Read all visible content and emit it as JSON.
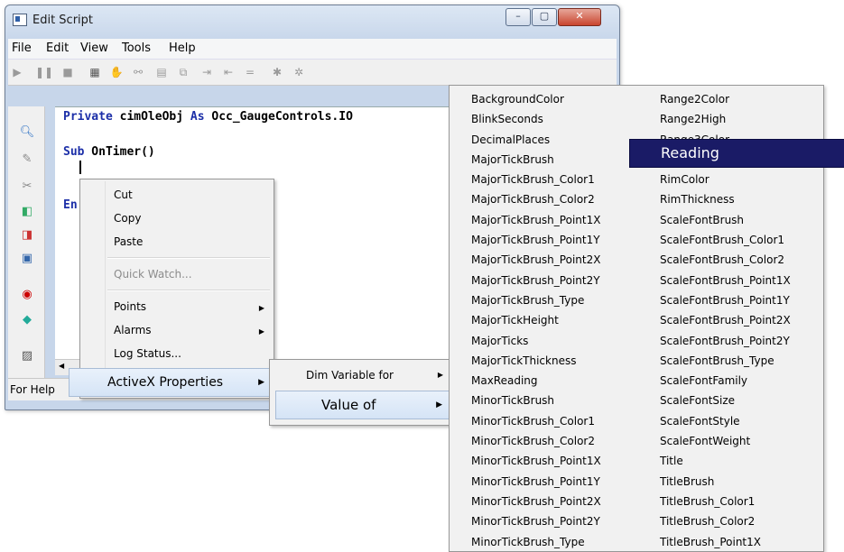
{
  "window": {
    "title": "Edit Script",
    "controls": {
      "minimize": "–",
      "maximize": "▢",
      "close": "✕"
    }
  },
  "menubar": [
    "File",
    "Edit",
    "View",
    "Tools",
    "Help"
  ],
  "code": {
    "line1_kw": "Private",
    "line1_rest": " cimOleObj ",
    "line1_kw2": "As",
    "line1_rest2": " Occ_GaugeControls.IO",
    "line2_kw": "Sub",
    "line2_rest": " OnTimer()",
    "line4_kw": "En"
  },
  "status": {
    "text": "For Help"
  },
  "context_menu": {
    "cut": "Cut",
    "copy": "Copy",
    "paste": "Paste",
    "quick_watch": "Quick Watch...",
    "points": "Points",
    "alarms": "Alarms",
    "log_status": "Log Status...",
    "activex": "ActiveX Properties"
  },
  "submenu": {
    "dim_variable": "Dim Variable for",
    "value_of": "Value of"
  },
  "properties": {
    "col1": [
      "BackgroundColor",
      "BlinkSeconds",
      "DecimalPlaces",
      "MajorTickBrush",
      "MajorTickBrush_Color1",
      "MajorTickBrush_Color2",
      "MajorTickBrush_Point1X",
      "MajorTickBrush_Point1Y",
      "MajorTickBrush_Point2X",
      "MajorTickBrush_Point2Y",
      "MajorTickBrush_Type",
      "MajorTickHeight",
      "MajorTicks",
      "MajorTickThickness",
      "MaxReading",
      "MinorTickBrush",
      "MinorTickBrush_Color1",
      "MinorTickBrush_Color2",
      "MinorTickBrush_Point1X",
      "MinorTickBrush_Point1Y",
      "MinorTickBrush_Point2X",
      "MinorTickBrush_Point2Y",
      "MinorTickBrush_Type"
    ],
    "col2": [
      "Range2Color",
      "Range2High",
      "Range3Color",
      "Reading",
      "RimColor",
      "RimThickness",
      "ScaleFontBrush",
      "ScaleFontBrush_Color1",
      "ScaleFontBrush_Color2",
      "ScaleFontBrush_Point1X",
      "ScaleFontBrush_Point1Y",
      "ScaleFontBrush_Point2X",
      "ScaleFontBrush_Point2Y",
      "ScaleFontBrush_Type",
      "ScaleFontFamily",
      "ScaleFontSize",
      "ScaleFontStyle",
      "ScaleFontWeight",
      "Title",
      "TitleBrush",
      "TitleBrush_Color1",
      "TitleBrush_Color2",
      "TitleBrush_Point1X"
    ],
    "highlighted": "Reading",
    "highlight_color": "#1a1b66"
  }
}
